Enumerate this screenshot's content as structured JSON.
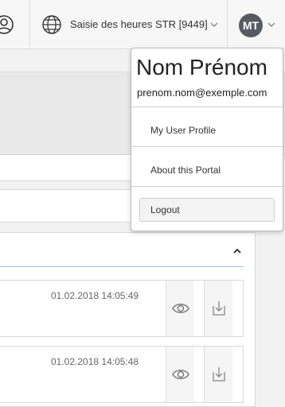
{
  "header": {
    "portal_label": "Saisie des heures STR [9449]",
    "avatar_initials": "MT"
  },
  "panel": {
    "rows": [
      {
        "date": "01.02.2018 14:05:49"
      },
      {
        "date": "01.02.2018 14:05:48"
      }
    ]
  },
  "user_menu": {
    "name": "Nom Prénom",
    "email": "prenom.nom@exemple.com",
    "items": [
      {
        "label": "My User Profile"
      },
      {
        "label": "About this Portal"
      }
    ],
    "logout_label": "Logout"
  },
  "colors": {
    "avatar_bg": "#555b61",
    "panel_header_border": "#9fc3d6"
  },
  "icons": [
    "user-circle-icon",
    "globe-icon",
    "chevron-down-icon",
    "chevron-up-icon",
    "eye-icon",
    "download-icon"
  ]
}
